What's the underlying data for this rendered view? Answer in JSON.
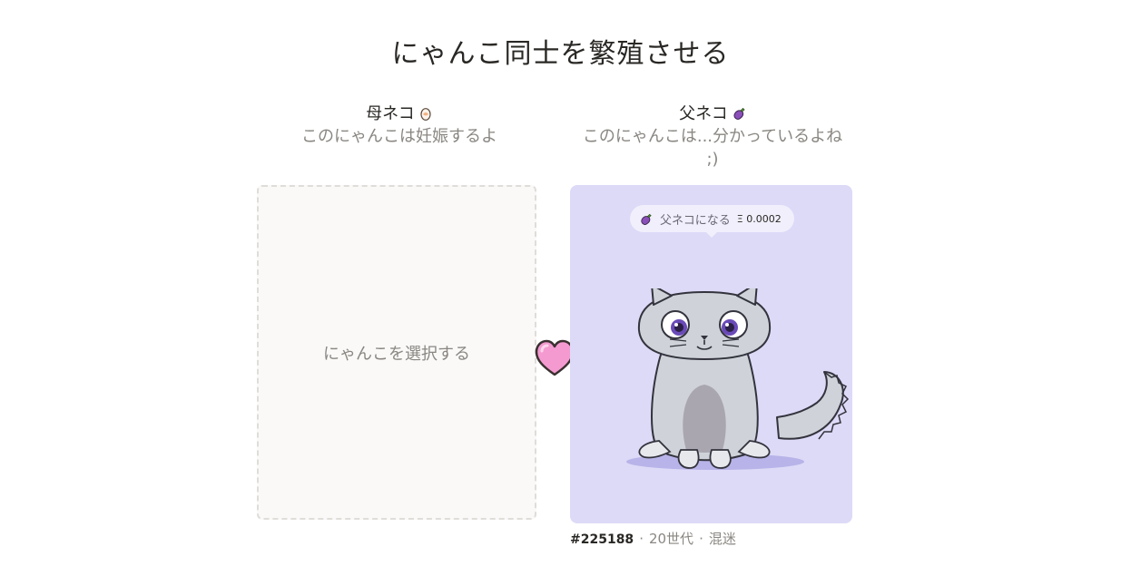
{
  "page": {
    "title": "にゃんこ同士を繁殖させる"
  },
  "mother": {
    "role_label": "母ネコ",
    "role_icon": "egg-icon",
    "description": "このにゃんこは妊娠するよ",
    "select_label": "にゃんこを選択する"
  },
  "father": {
    "role_label": "父ネコ",
    "role_icon": "eggplant-icon",
    "description": "このにゃんこは...分かっているよね ;)",
    "badge": {
      "label": "父ネコになる",
      "price": "Ξ 0.0002",
      "icon": "eggplant-icon"
    },
    "cat": {
      "id": "#225188",
      "generation": "20世代",
      "cooldown": "混迷"
    }
  },
  "colors": {
    "card_background": "#dcdaf7",
    "heart": "#f49ad1",
    "empty_slot_background": "#faf9f8"
  },
  "separator": "·"
}
